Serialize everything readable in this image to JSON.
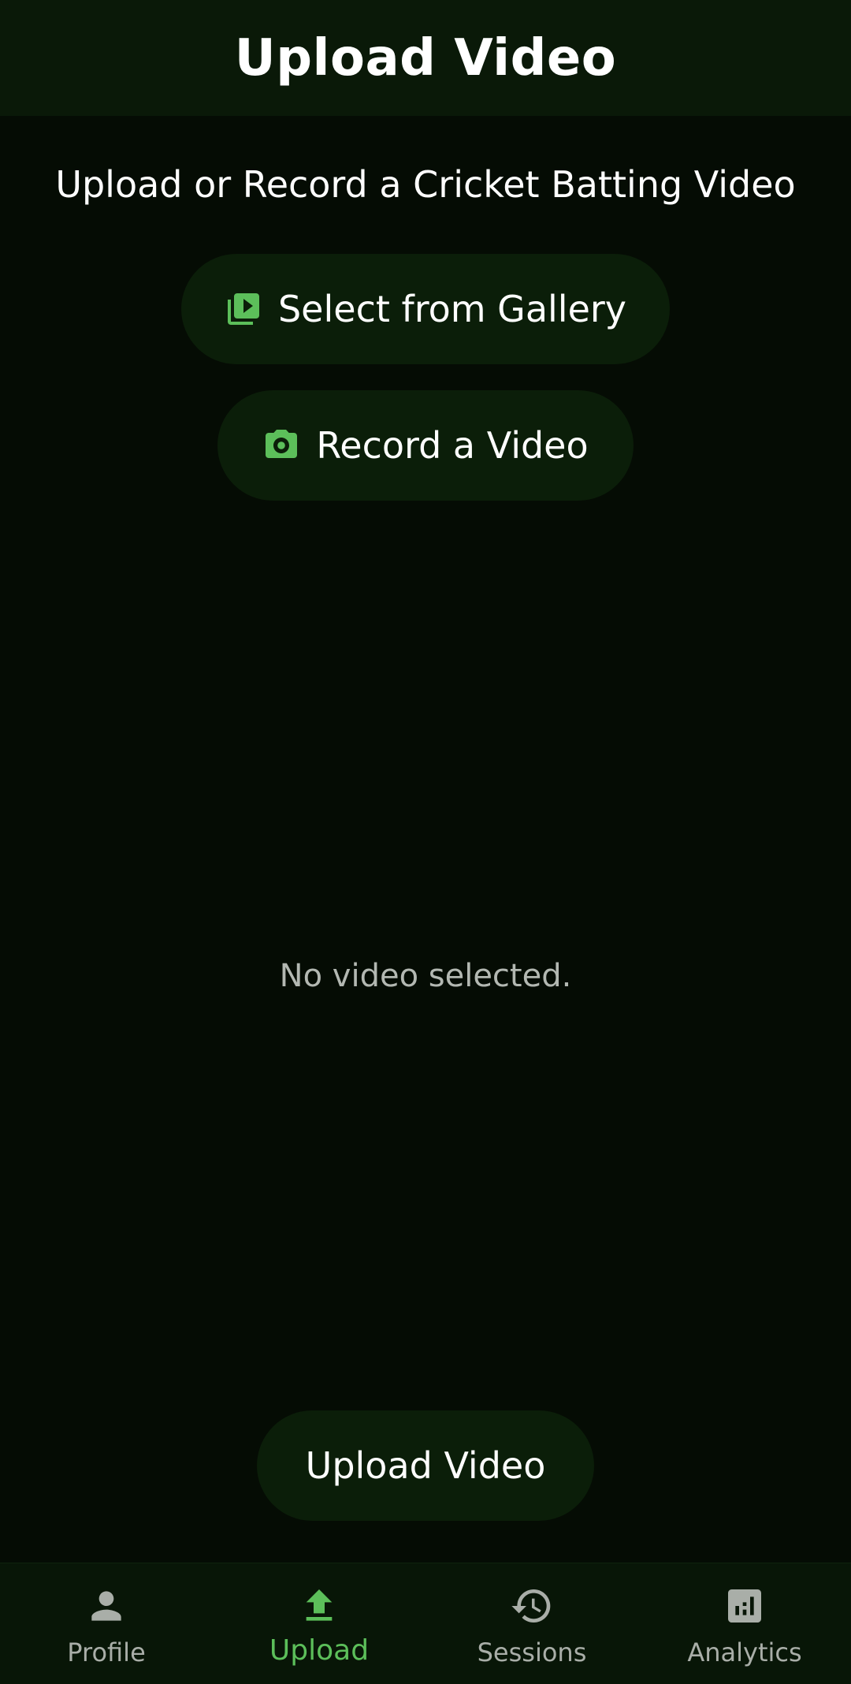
{
  "app_bar": {
    "title": "Upload Video"
  },
  "main": {
    "heading": "Upload or Record a Cricket Batting Video",
    "gallery_button": {
      "label": "Select from Gallery",
      "icon": "video-library-icon"
    },
    "record_button": {
      "label": "Record a Video",
      "icon": "camera-icon"
    },
    "empty_state": "No video selected.",
    "upload_button": {
      "label": "Upload Video"
    }
  },
  "bottom_nav": {
    "items": [
      {
        "label": "Profile",
        "icon": "person-icon",
        "active": false
      },
      {
        "label": "Upload",
        "icon": "upload-icon",
        "active": true
      },
      {
        "label": "Sessions",
        "icon": "history-icon",
        "active": false
      },
      {
        "label": "Analytics",
        "icon": "analytics-icon",
        "active": false
      }
    ]
  },
  "colors": {
    "background": "#050c04",
    "app_bar": "#0a1908",
    "button": "#0b1e09",
    "accent": "#5cbf5a",
    "inactive": "#a9aea8"
  }
}
